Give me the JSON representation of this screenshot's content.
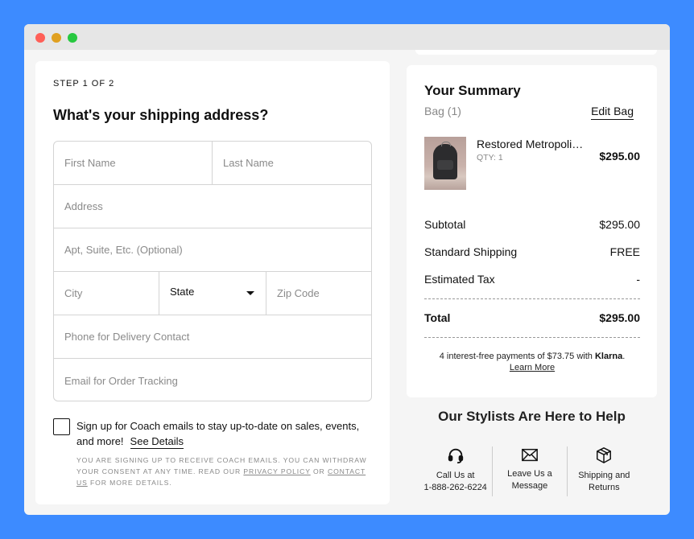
{
  "window": {
    "controls": [
      "close",
      "minimize",
      "maximize"
    ]
  },
  "shipping": {
    "step": "STEP 1 OF 2",
    "heading": "What's your shipping address?",
    "fields": {
      "first_name": "First Name",
      "last_name": "Last Name",
      "address": "Address",
      "apt": "Apt, Suite, Etc. (Optional)",
      "city": "City",
      "state": "State",
      "zip": "Zip Code",
      "phone": "Phone for Delivery Contact",
      "email": "Email for Order Tracking"
    },
    "signup": {
      "checked": false,
      "text": "Sign up for Coach emails to stay up-to-date on sales, events, and more!",
      "see_details": "See Details",
      "legal_1": "YOU ARE SIGNING UP TO RECEIVE COACH EMAILS. YOU CAN WITHDRAW YOUR CONSENT AT ANY TIME. READ OUR ",
      "privacy_policy": "PRIVACY POLICY",
      "legal_2": " OR ",
      "contact_us": "CONTACT US",
      "legal_3": " FOR MORE DETAILS."
    }
  },
  "summary": {
    "title": "Your Summary",
    "bag": "Bag (1)",
    "edit_bag": "Edit Bag",
    "item": {
      "name": "Restored Metropolitan Backpack",
      "qty": "QTY: 1",
      "price": "$295.00"
    },
    "lines": [
      {
        "label": "Subtotal",
        "value": "$295.00"
      },
      {
        "label": "Standard Shipping",
        "value": "FREE"
      },
      {
        "label": "Estimated Tax",
        "value": "-"
      }
    ],
    "total": {
      "label": "Total",
      "value": "$295.00"
    },
    "klarna": {
      "text": "4 interest-free payments of $73.75 with ",
      "brand": "Klarna",
      "period": ".",
      "learn_more": "Learn More"
    }
  },
  "help": {
    "title": "Our Stylists Are Here to Help",
    "items": [
      {
        "icon": "headset-icon",
        "line1": "Call Us at",
        "line2": "1-888-262-6224"
      },
      {
        "icon": "envelope-icon",
        "line1": "Leave Us a",
        "line2": "Message"
      },
      {
        "icon": "box-icon",
        "line1": "Shipping and",
        "line2": "Returns"
      }
    ]
  }
}
